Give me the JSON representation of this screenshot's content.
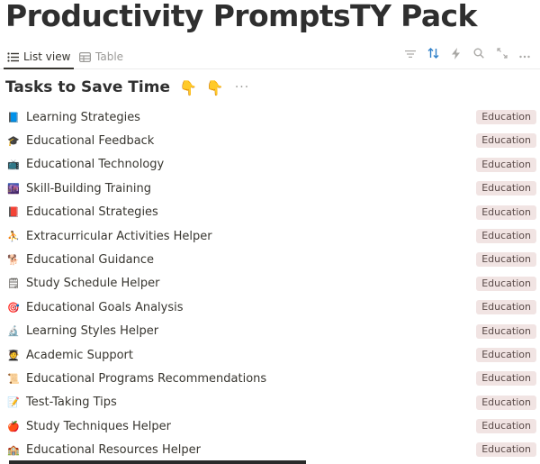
{
  "page": {
    "title": "Productivity PromptsTY Pack"
  },
  "views": {
    "tabs": [
      {
        "label": "List view",
        "icon": "list-icon",
        "active": true
      },
      {
        "label": "Table",
        "icon": "table-icon",
        "active": false
      }
    ]
  },
  "toolbar": {
    "icons": [
      "filter-icon",
      "sort-icon",
      "automation-icon",
      "search-icon",
      "expand-icon",
      "more-icon"
    ],
    "accent_color": "#2f80c9"
  },
  "section": {
    "title": "Tasks to Save Time",
    "emoji1": "👇",
    "emoji2": "👇",
    "more": "···"
  },
  "items": [
    {
      "emoji": "📘",
      "icon_name": "blue-book-icon",
      "label": "Learning Strategies",
      "tag": "Education"
    },
    {
      "emoji": "🎓",
      "icon_name": "graduation-cap-icon",
      "label": "Educational Feedback",
      "tag": "Education"
    },
    {
      "emoji": "📺",
      "icon_name": "television-icon",
      "label": "Educational Technology",
      "tag": "Education"
    },
    {
      "emoji": "🌆",
      "icon_name": "cityscape-icon",
      "label": "Skill-Building Training",
      "tag": "Education"
    },
    {
      "emoji": "📕",
      "icon_name": "red-book-icon",
      "label": "Educational Strategies",
      "tag": "Education"
    },
    {
      "emoji": "⛹",
      "icon_name": "person-activity-icon",
      "label": "Extracurricular Activities Helper",
      "tag": "Education"
    },
    {
      "emoji": "🐕",
      "icon_name": "guide-dog-icon",
      "label": "Educational Guidance",
      "tag": "Education"
    },
    {
      "emoji": "🗒",
      "icon_name": "notepad-icon",
      "label": "Study Schedule Helper",
      "tag": "Education"
    },
    {
      "emoji": "🎯",
      "icon_name": "target-icon",
      "label": "Educational Goals Analysis",
      "tag": "Education"
    },
    {
      "emoji": "🔬",
      "icon_name": "microscope-icon",
      "label": "Learning Styles Helper",
      "tag": "Education"
    },
    {
      "emoji": "🧑‍🎓",
      "icon_name": "student-icon",
      "label": "Academic Support",
      "tag": "Education"
    },
    {
      "emoji": "📜",
      "icon_name": "scroll-icon",
      "label": "Educational Programs Recommendations",
      "tag": "Education"
    },
    {
      "emoji": "📝",
      "icon_name": "memo-icon",
      "label": "Test-Taking Tips",
      "tag": "Education"
    },
    {
      "emoji": "🍎",
      "icon_name": "apple-icon",
      "label": "Study Techniques Helper",
      "tag": "Education"
    },
    {
      "emoji": "🏫",
      "icon_name": "school-icon",
      "label": "Educational Resources Helper",
      "tag": "Education"
    }
  ],
  "colors": {
    "tag_bg": "#f1e4e3",
    "tag_text": "#5a4a48"
  }
}
